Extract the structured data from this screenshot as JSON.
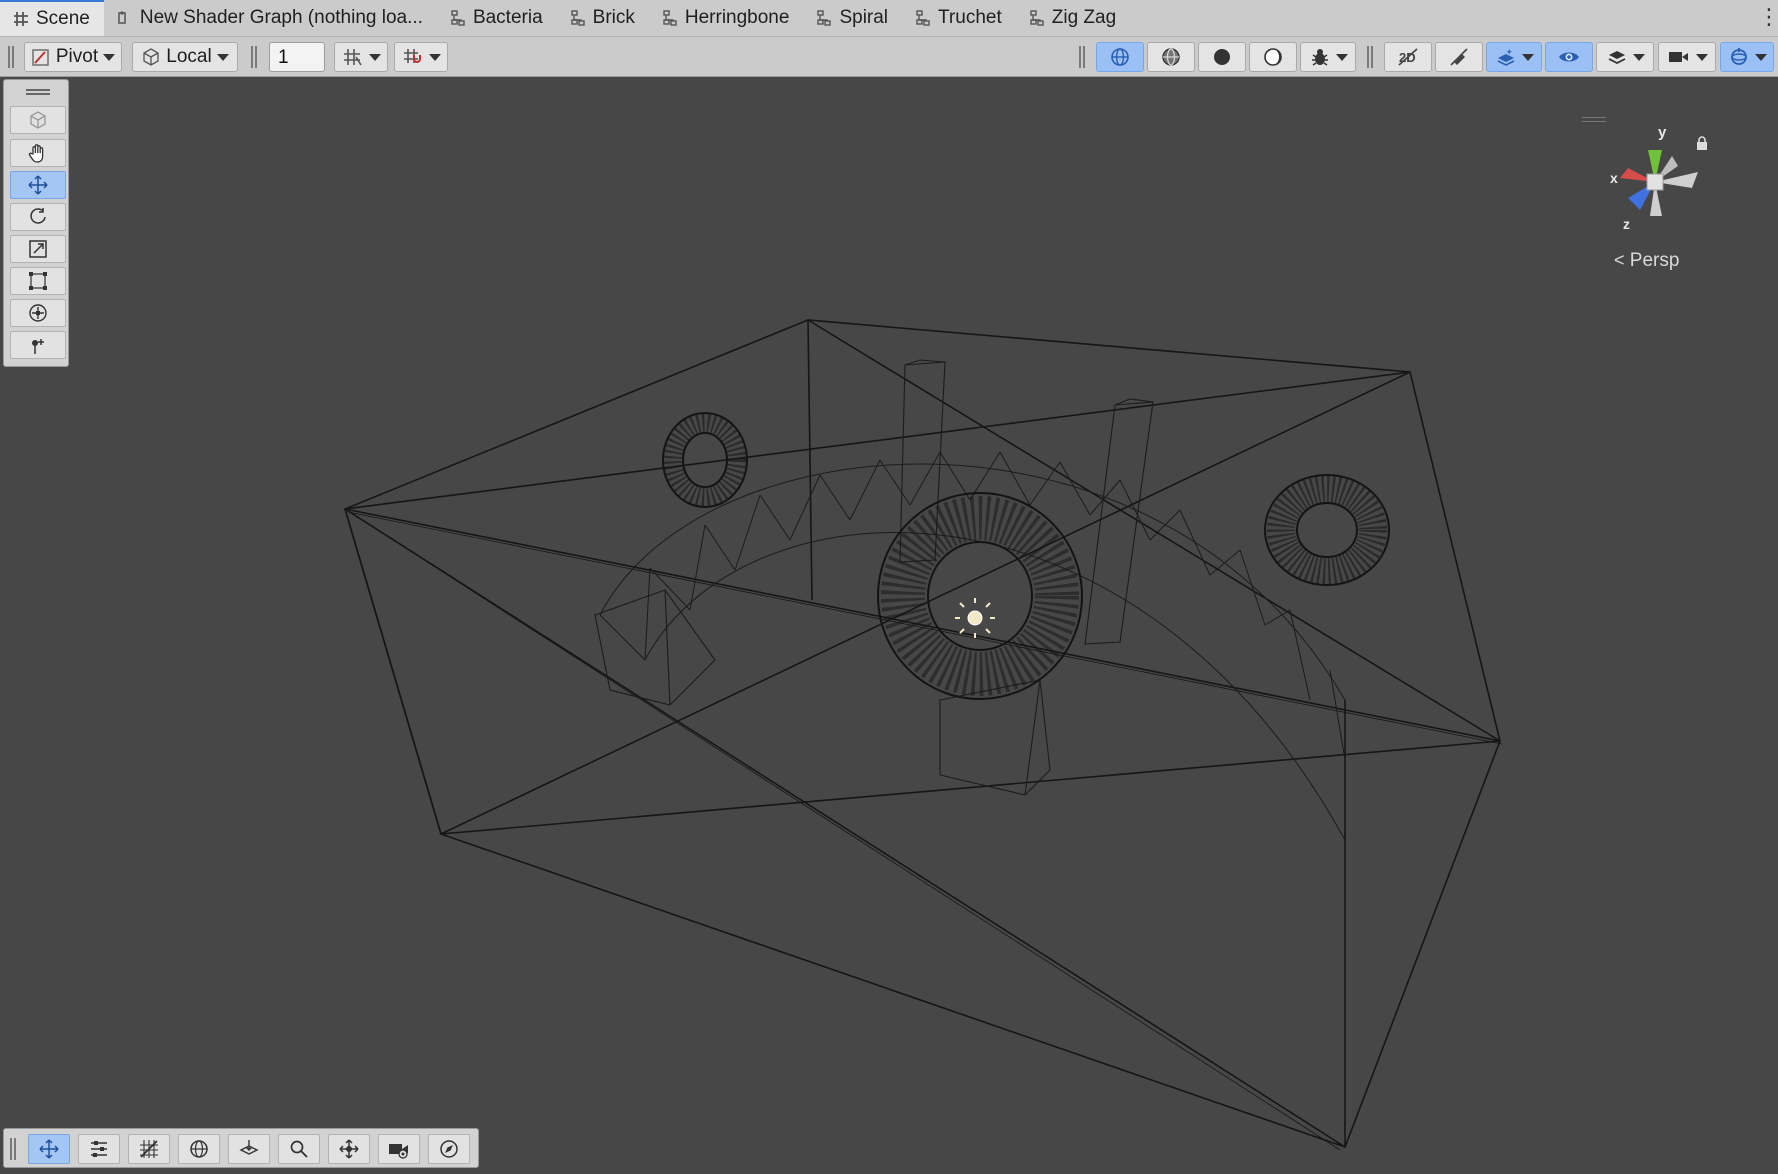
{
  "tabs": [
    {
      "label": "Scene",
      "icon": "scene-grid-icon",
      "active": true
    },
    {
      "label": "New Shader Graph (nothing loa...",
      "icon": "shader-graph-icon",
      "active": false
    },
    {
      "label": "Bacteria",
      "icon": "shader-graph-icon",
      "active": false
    },
    {
      "label": "Brick",
      "icon": "shader-graph-icon",
      "active": false
    },
    {
      "label": "Herringbone",
      "icon": "shader-graph-icon",
      "active": false
    },
    {
      "label": "Spiral",
      "icon": "shader-graph-icon",
      "active": false
    },
    {
      "label": "Truchet",
      "icon": "shader-graph-icon",
      "active": false
    },
    {
      "label": "Zig Zag",
      "icon": "shader-graph-icon",
      "active": false
    }
  ],
  "toolbar": {
    "pivot_label": "Pivot",
    "local_label": "Local",
    "grid_value": "1"
  },
  "gizmo": {
    "y_label": "y",
    "x_label": "x",
    "z_label": "z",
    "persp_label": "Persp"
  },
  "colors": {
    "scene_background": "#474747",
    "wire": "#1a1a1a",
    "accent": "#3a79d8",
    "toggle_on": "#9ac0f5"
  }
}
